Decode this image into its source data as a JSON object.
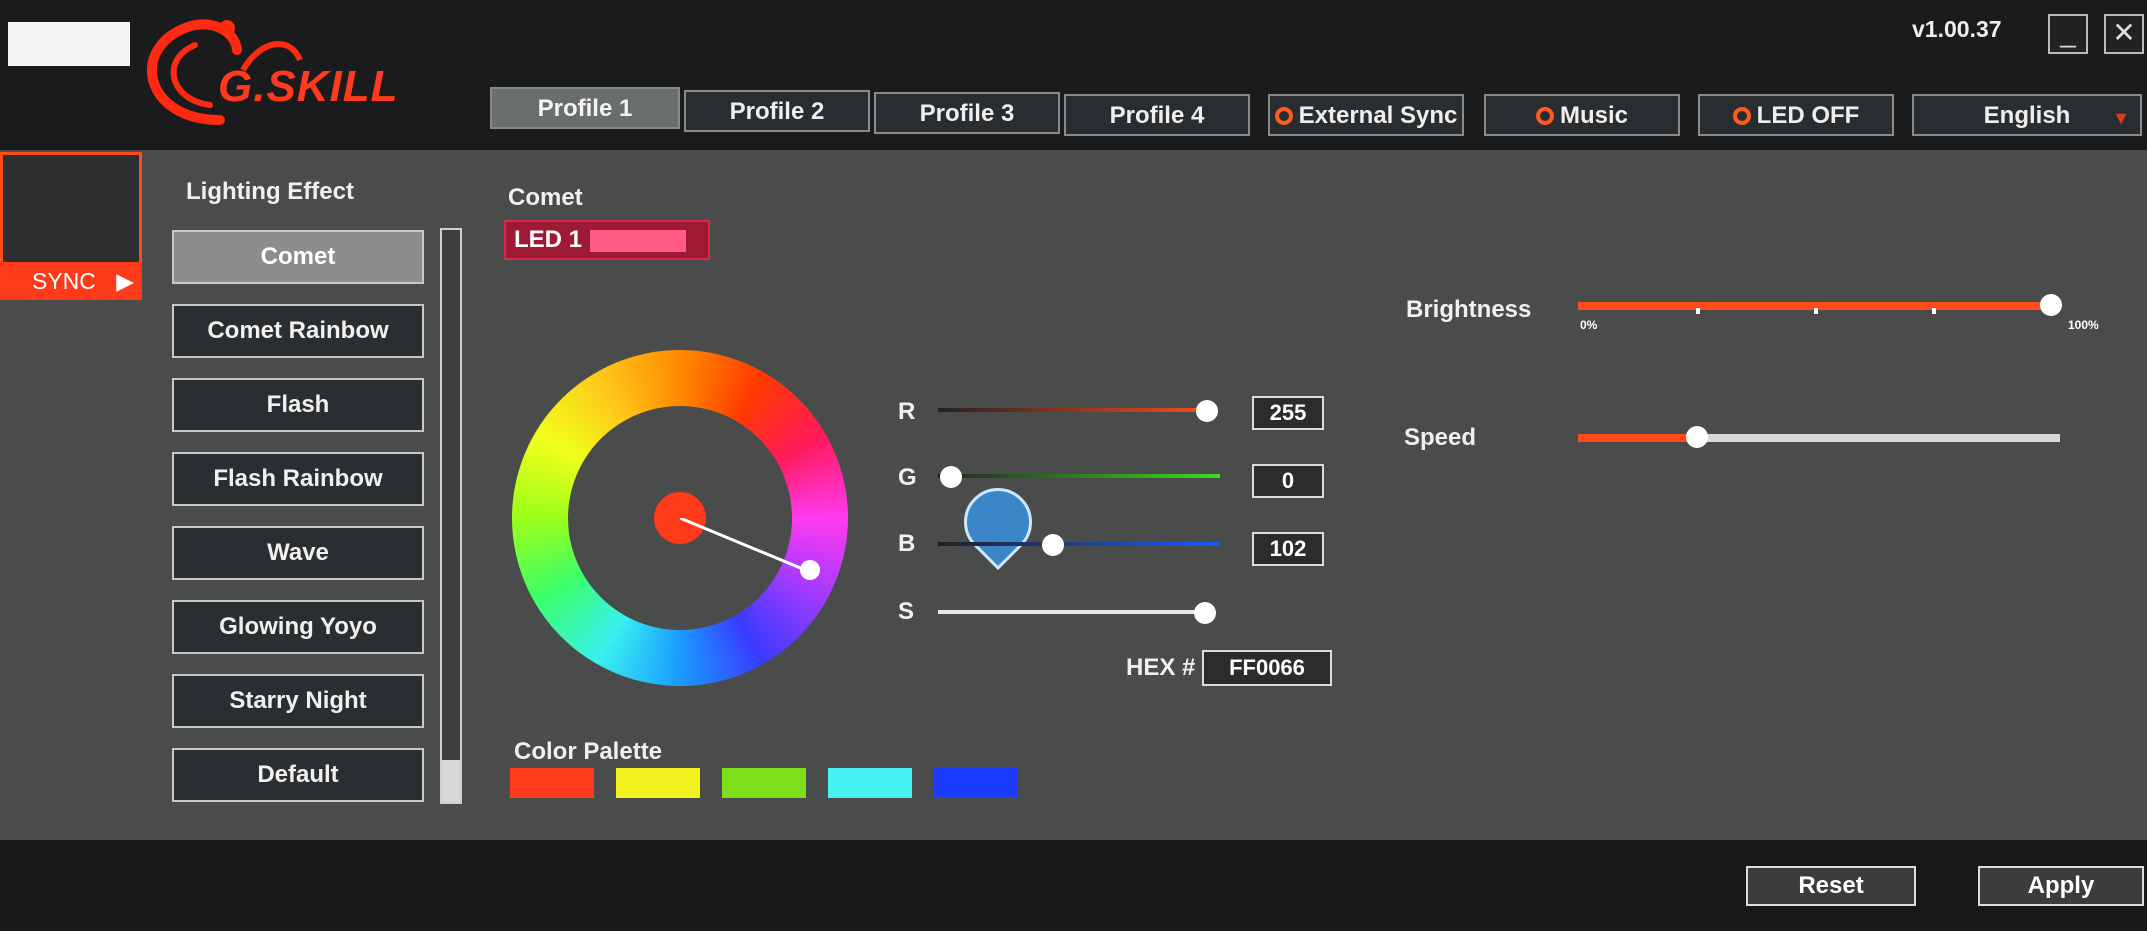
{
  "header": {
    "brand": "G.SKILL",
    "version": "v1.00.37",
    "minimize_label": "_",
    "close_label": "✕"
  },
  "profiles": [
    {
      "label": "Profile 1",
      "active": true
    },
    {
      "label": "Profile 2",
      "active": false
    },
    {
      "label": "Profile 3",
      "active": false
    },
    {
      "label": "Profile 4",
      "active": false
    }
  ],
  "toggles": {
    "external_sync": "External Sync",
    "music": "Music",
    "led_off": "LED OFF"
  },
  "language": {
    "selected": "English",
    "icon": "triangle-down"
  },
  "sidebar": {
    "sync_label": "SYNC",
    "arrow_icon": "play-right"
  },
  "lighting": {
    "heading": "Lighting Effect",
    "effects": [
      "Comet",
      "Comet Rainbow",
      "Flash",
      "Flash Rainbow",
      "Wave",
      "Glowing Yoyo",
      "Starry Night",
      "Default"
    ],
    "selected": "Comet"
  },
  "effect_panel": {
    "title": "Comet",
    "led_label": "LED 1",
    "led_color": "#ff5a85"
  },
  "color": {
    "r_label": "R",
    "r_value": "255",
    "g_label": "G",
    "g_value": "0",
    "b_label": "B",
    "b_value": "102",
    "s_label": "S",
    "hex_label": "HEX #",
    "hex_value": "FF0066",
    "current": "#ff3a1a"
  },
  "palette": {
    "heading": "Color Palette",
    "colors": [
      "#ff3a1a",
      "#f2f21e",
      "#7ee01a",
      "#44f0f0",
      "#1a3cff"
    ]
  },
  "brightness": {
    "label": "Brightness",
    "min_label": "0%",
    "max_label": "100%",
    "value": 100
  },
  "speed": {
    "label": "Speed",
    "value": 25
  },
  "footer": {
    "reset_label": "Reset",
    "apply_label": "Apply"
  },
  "accent": "#ff3a1a"
}
